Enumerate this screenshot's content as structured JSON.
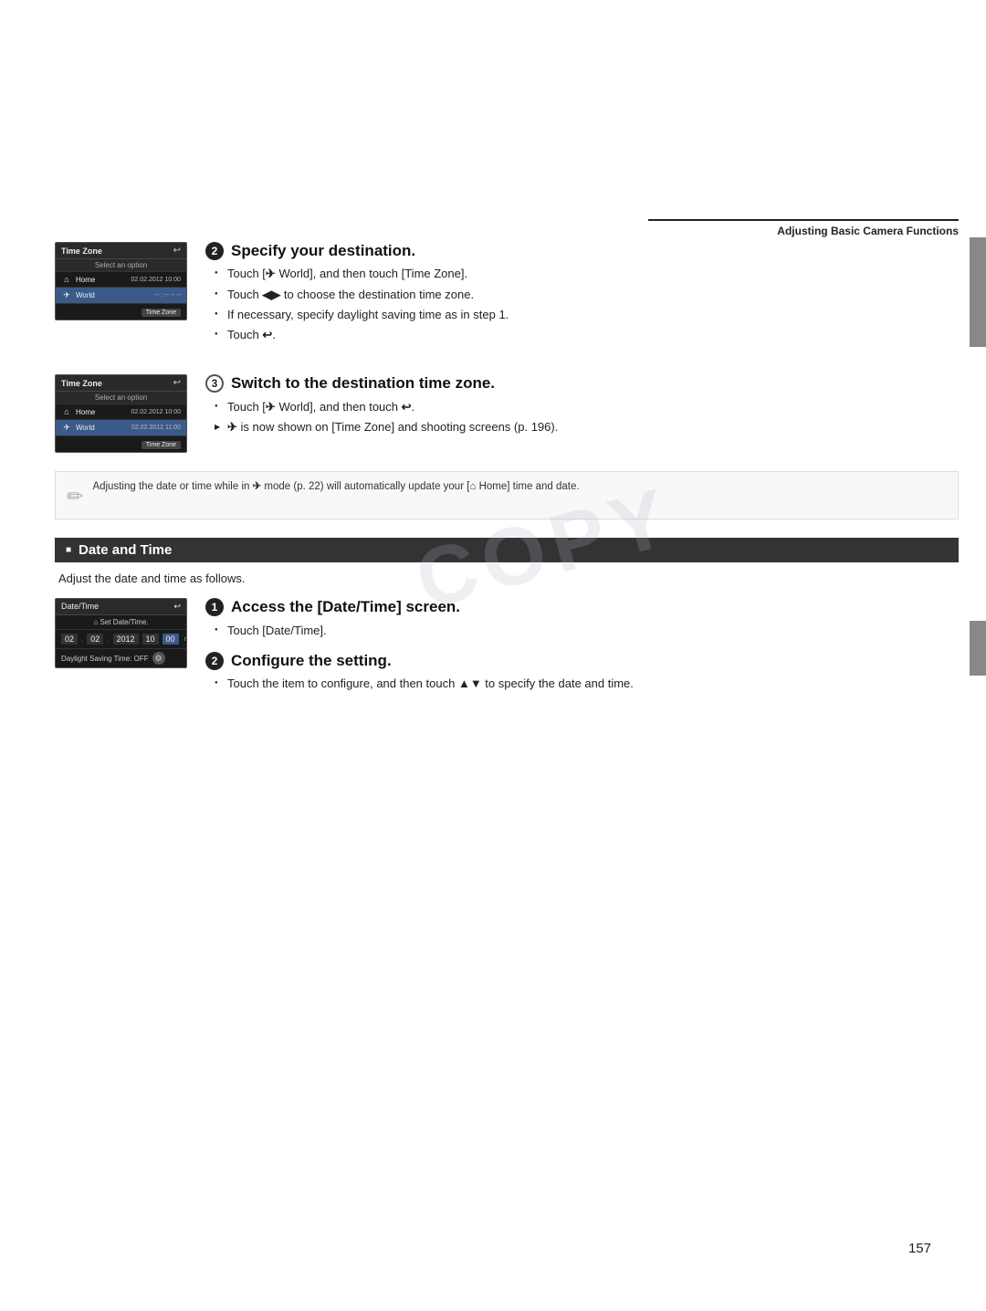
{
  "page": {
    "number": "157",
    "watermark": "COPY"
  },
  "header": {
    "title": "Adjusting Basic Camera Functions"
  },
  "section2": {
    "step_number": "2",
    "title": "Specify your destination.",
    "bullets": [
      "Touch [✈ World], and then touch [Time Zone].",
      "Touch ◀▶ to choose the destination time zone.",
      "If necessary, specify daylight saving time as in step 1.",
      "Touch ↩."
    ],
    "cam_ui": {
      "title": "Time Zone",
      "subtitle": "Select an option",
      "rows": [
        {
          "icon": "⌂",
          "label": "Home",
          "value": "02.02.2012 10:00",
          "selected": false
        },
        {
          "icon": "✈",
          "label": "World",
          "value": "- - : - - - - - -",
          "selected": true
        }
      ],
      "footer_btn": "Time Zone"
    }
  },
  "section3": {
    "step_number": "3",
    "title": "Switch to the destination time zone.",
    "bullets_circle": [
      "Touch [✈ World], and then touch ↩."
    ],
    "bullets_arrow": [
      "✈ is now shown on [Time Zone] and shooting screens (p. 196)."
    ],
    "cam_ui": {
      "title": "Time Zone",
      "subtitle": "Select an option",
      "rows": [
        {
          "icon": "⌂",
          "label": "Home",
          "value": "02.02.2012 10:00",
          "selected": false
        },
        {
          "icon": "✈",
          "label": "World",
          "value": "02.02.2012 11:00",
          "selected": true
        }
      ],
      "footer_btn": "Time Zone"
    }
  },
  "note": {
    "text": "Adjusting the date or time while in ✈ mode (p. 22) will automatically update your [⌂ Home] time and date."
  },
  "date_time_section": {
    "title": "Date and Time",
    "subtitle": "Adjust the date and time as follows.",
    "step1": {
      "number": "1",
      "title": "Access the [Date/Time] screen.",
      "bullets": [
        "Touch [Date/Time]."
      ]
    },
    "step2": {
      "number": "2",
      "title": "Configure the setting.",
      "bullets": [
        "Touch the item to configure, and then touch ▲▼ to specify the date and time."
      ]
    },
    "cam_ui": {
      "title": "Date/Time",
      "set_label": "🏠 Set Date/Time.",
      "date_parts": [
        "02",
        "02",
        "2012",
        "10",
        "00"
      ],
      "format": "mm/dd/yy",
      "saving_label": "Daylight Saving Time: OFF"
    }
  }
}
